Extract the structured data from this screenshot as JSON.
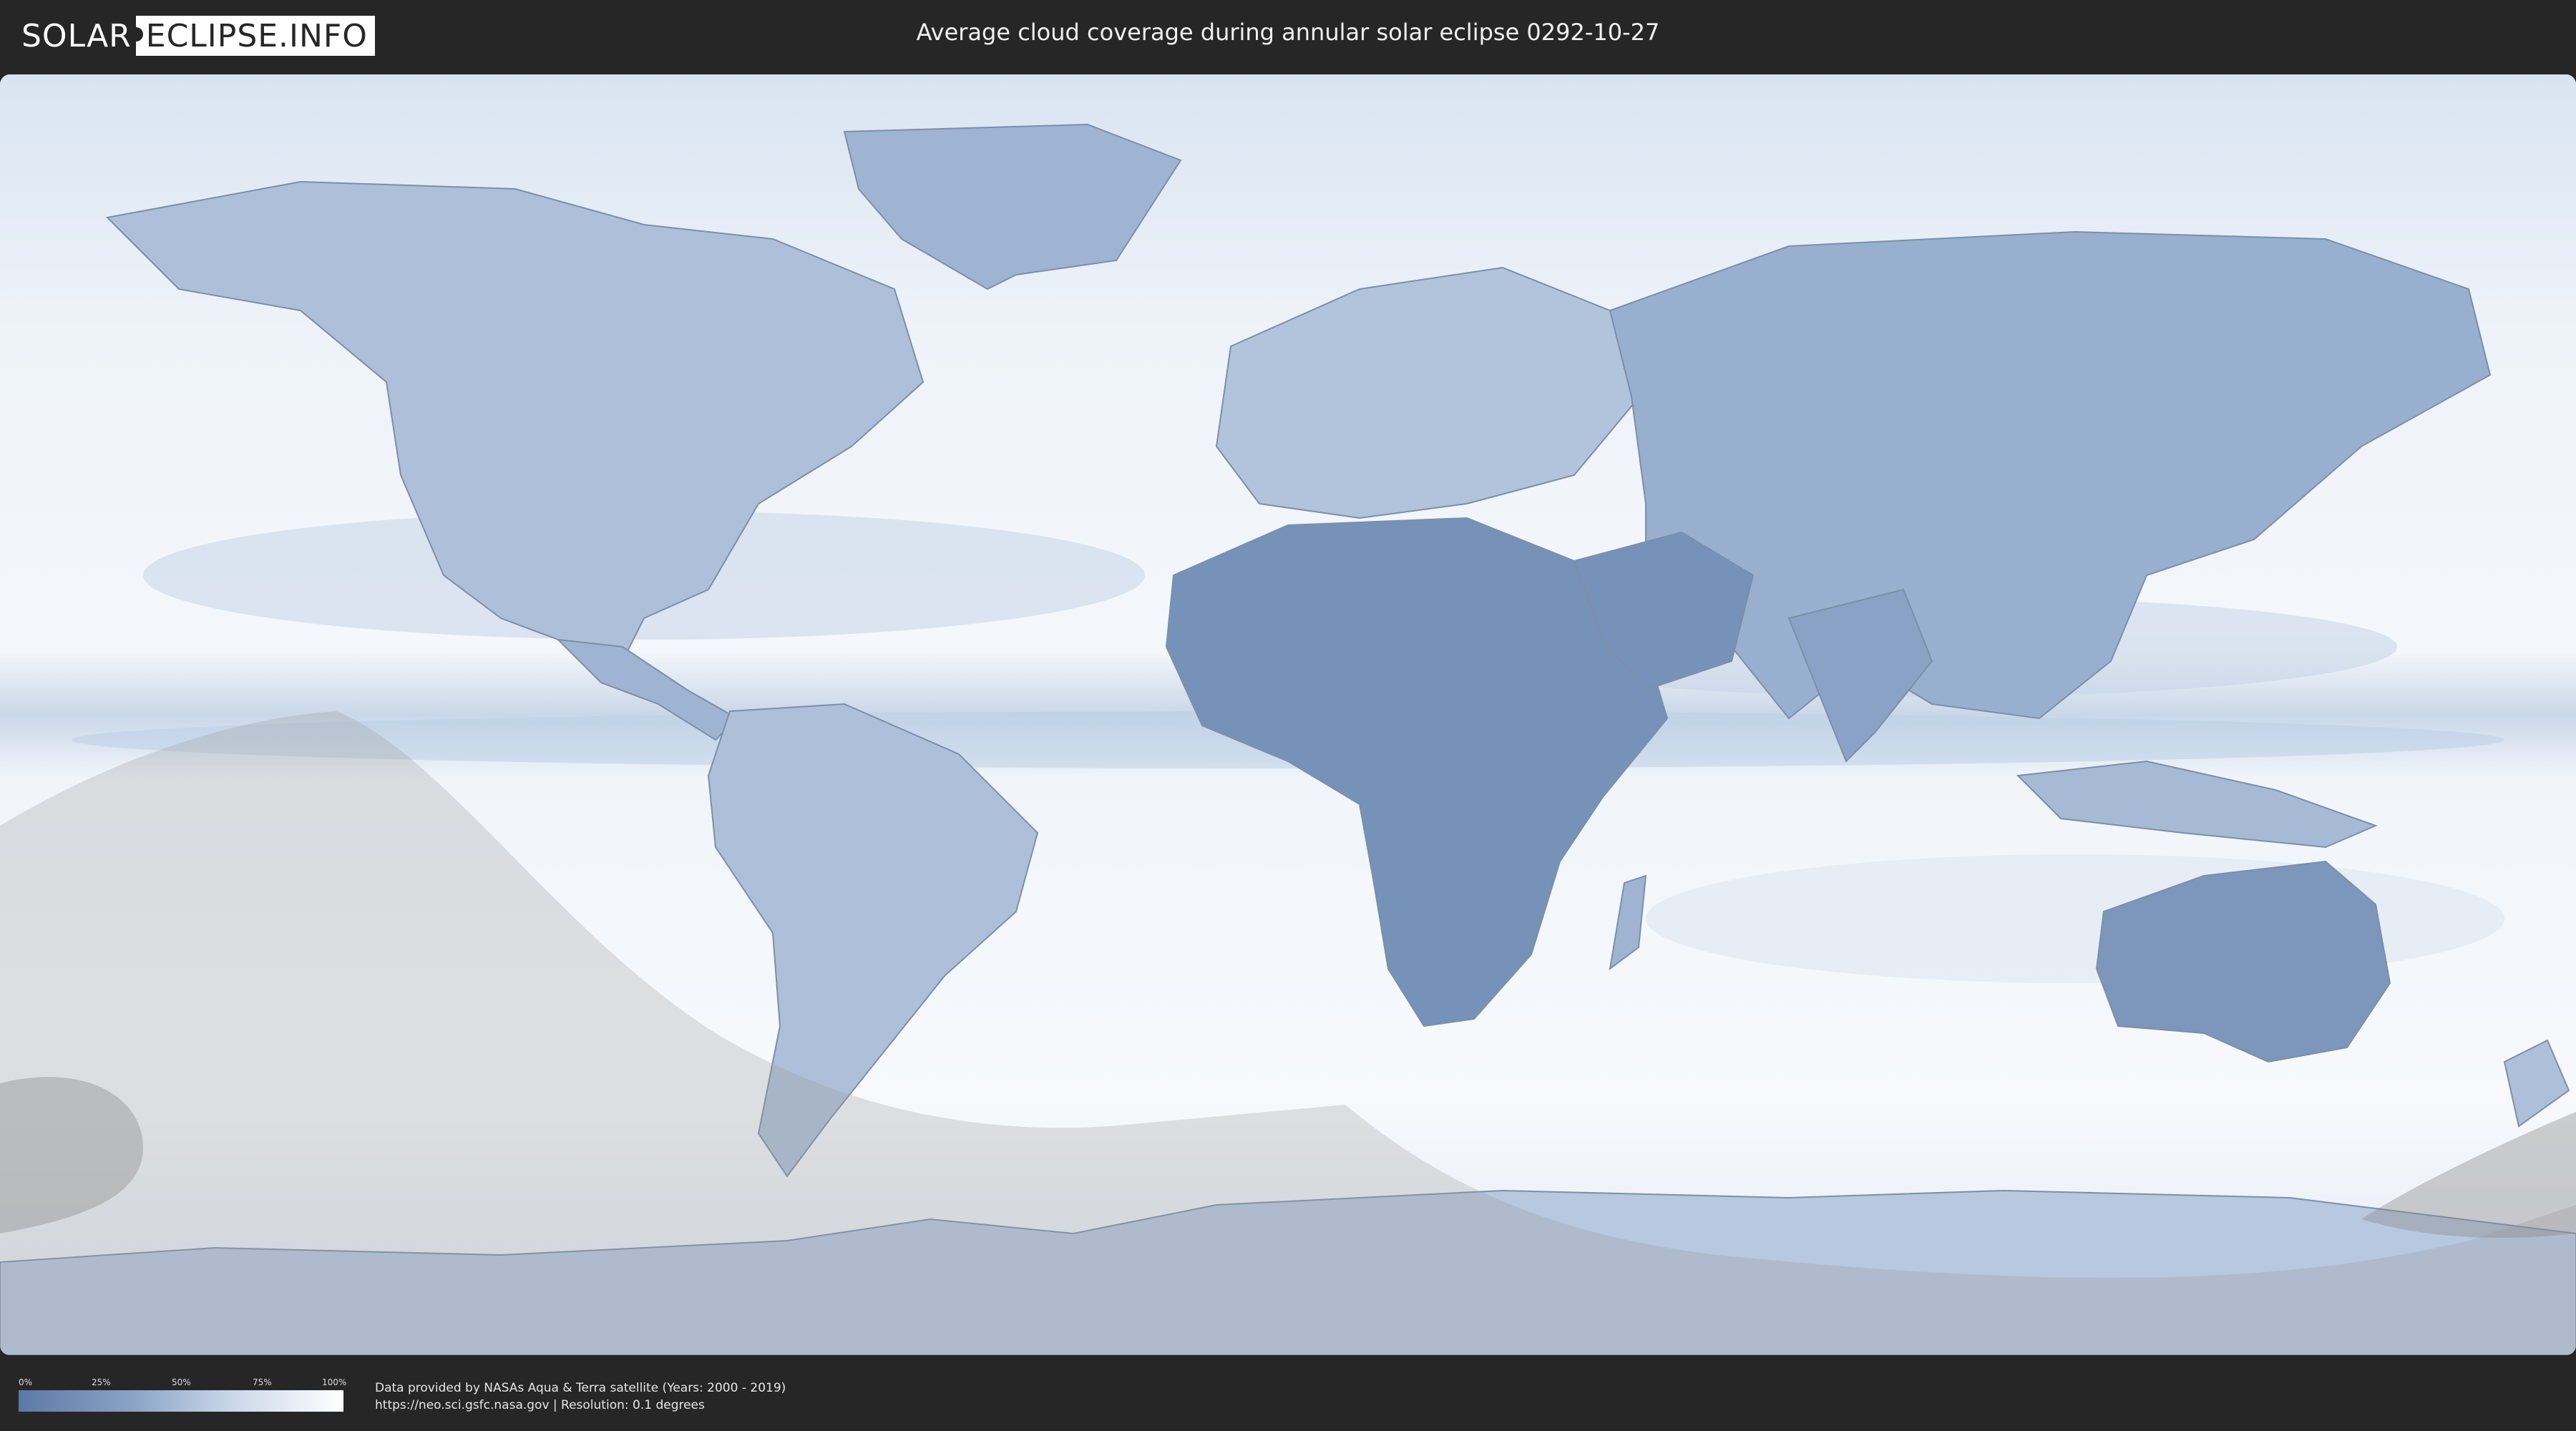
{
  "header": {
    "logo_part1": "SOLAR",
    "logo_part2": "ECLIPSE.INFO",
    "title": "Average cloud coverage during annular solar eclipse 0292-10-27"
  },
  "map": {
    "ocean_color": "#eef3f9",
    "land_clear_color": "#5c79a6",
    "eclipse_shadow_color": "#9a9a9a"
  },
  "legend": {
    "ticks": [
      "0%",
      "25%",
      "50%",
      "75%",
      "100%"
    ],
    "gradient_colors": [
      "#5c79a6",
      "#ffffff"
    ]
  },
  "footer": {
    "credit_line1": "Data provided by NASAs Aqua & Terra satellite (Years: 2000 - 2019)",
    "credit_line2": "https://neo.sci.gsfc.nasa.gov | Resolution: 0.1 degrees"
  }
}
